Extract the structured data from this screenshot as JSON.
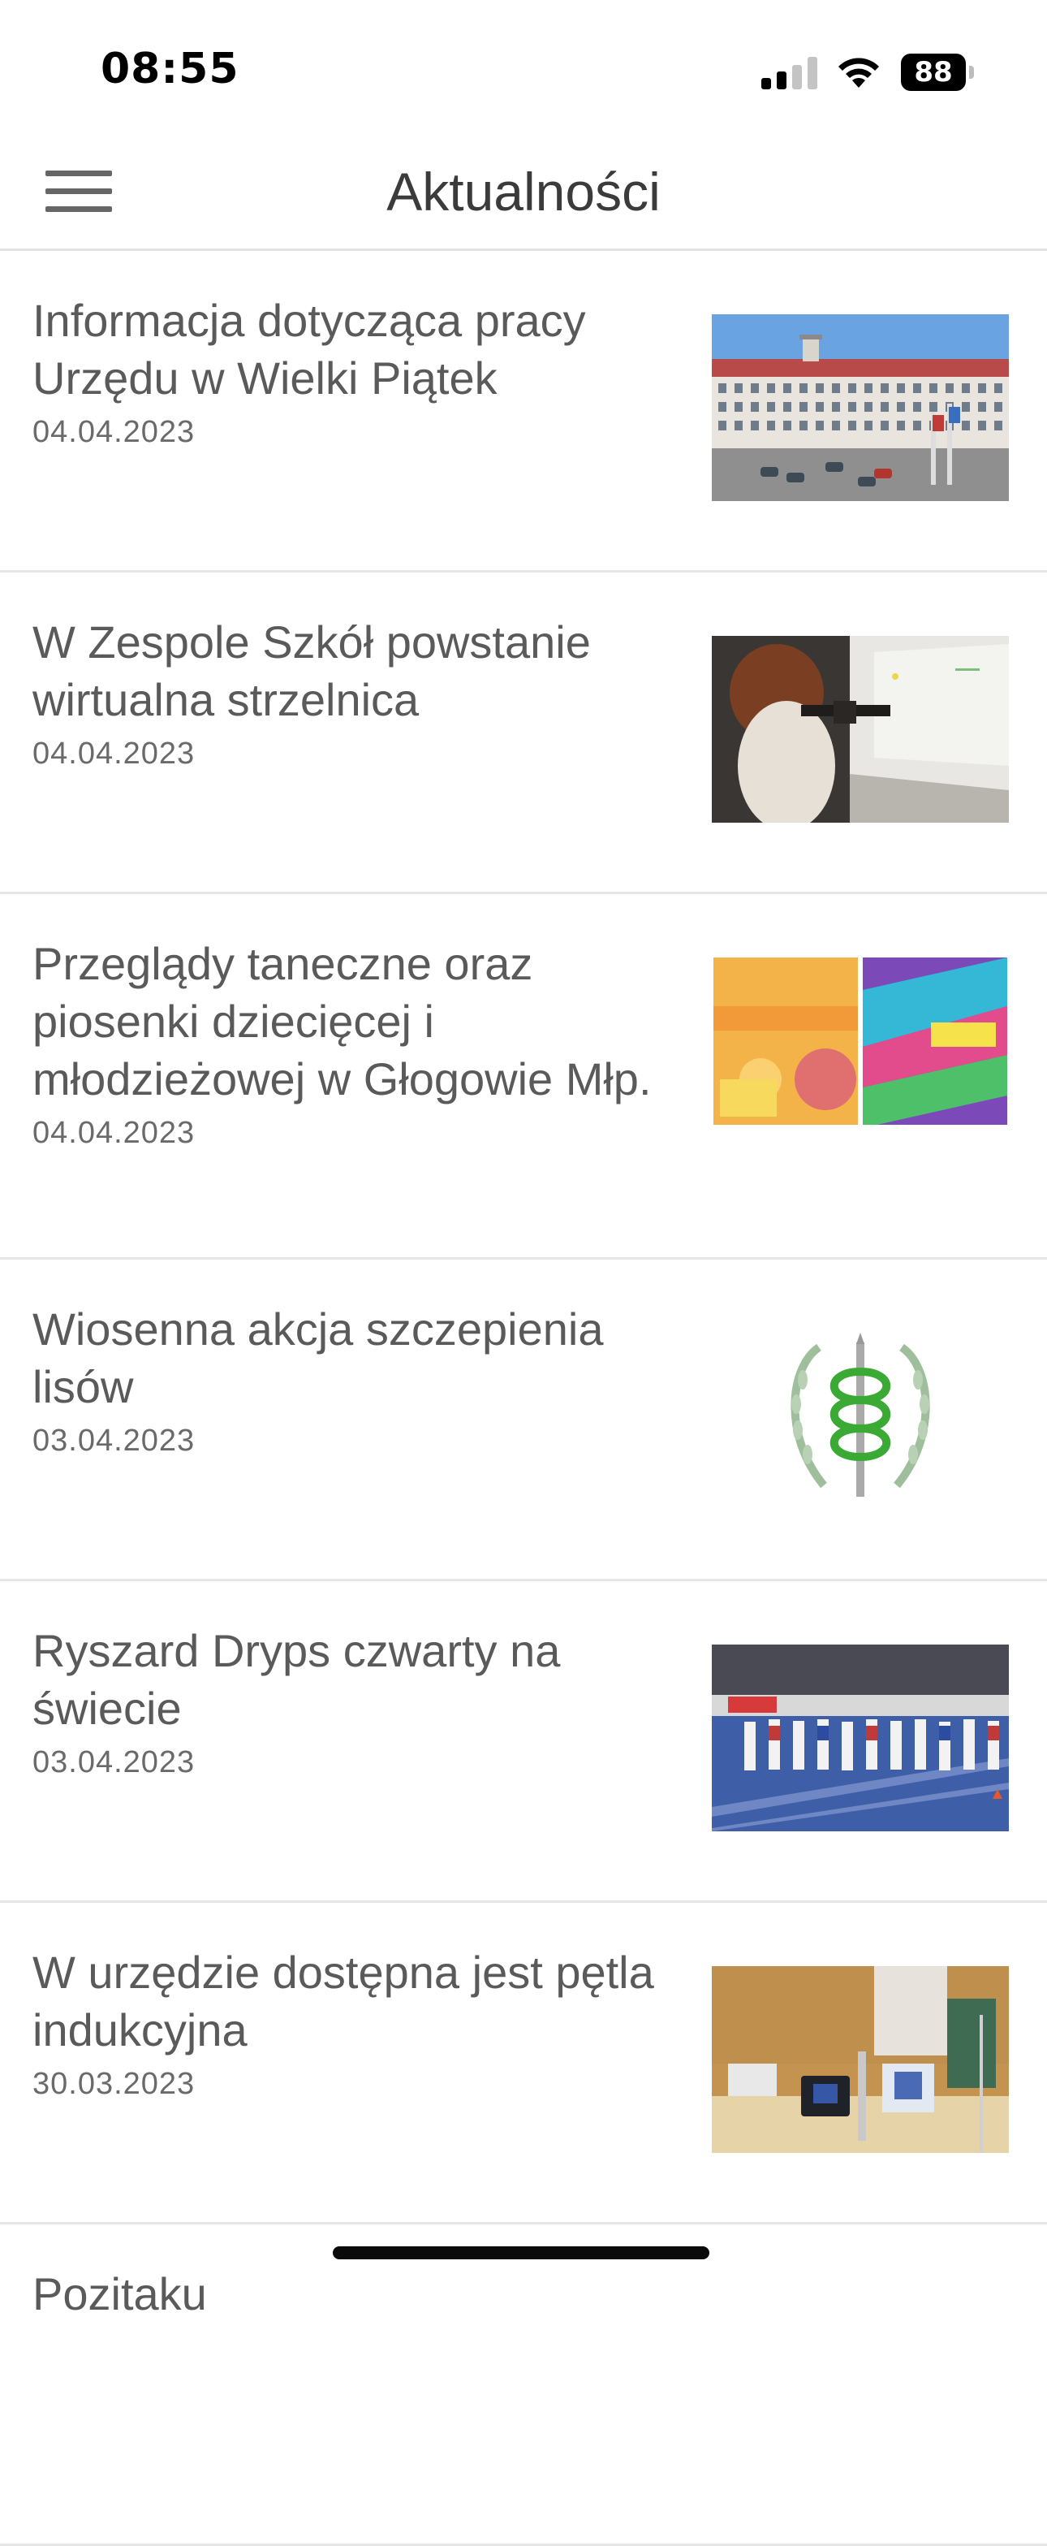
{
  "status_bar": {
    "time": "08:55",
    "battery": "88"
  },
  "header": {
    "title": "Aktualności"
  },
  "news": [
    {
      "title": "Informacja dotycząca pracy Urzędu w Wielki Piątek",
      "date": "04.04.2023",
      "thumbnail": "building-photo"
    },
    {
      "title": "W Zespole Szkół powstanie wirtualna strzelnica",
      "date": "04.04.2023",
      "thumbnail": "shooting-range-photo"
    },
    {
      "title": "Przeglądy taneczne oraz piosenki dziecięcej i młodzieżowej w Głogowie Młp.",
      "date": "04.04.2023",
      "thumbnail": "event-posters"
    },
    {
      "title": "Wiosenna akcja szczepienia lisów",
      "date": "03.04.2023",
      "thumbnail": "veterinary-emblem"
    },
    {
      "title": "Ryszard Dryps czwarty na świecie",
      "date": "03.04.2023",
      "thumbnail": "athletics-photo"
    },
    {
      "title": "W urzędzie dostępna jest pętla indukcyjna",
      "date": "30.03.2023",
      "thumbnail": "office-desk-photo"
    }
  ],
  "next_item_partial_title": "Pozitaku"
}
